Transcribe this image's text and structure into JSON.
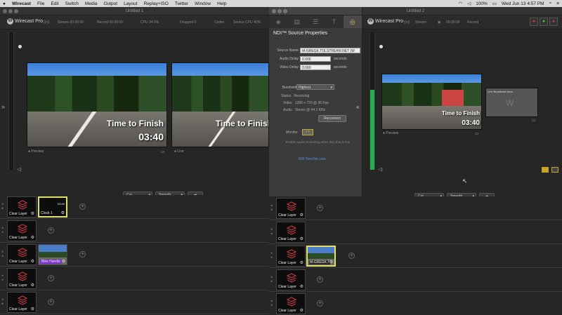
{
  "menubar": {
    "apple": "",
    "app_name": "Wirecast",
    "items": [
      "File",
      "Edit",
      "Switch",
      "Media",
      "Output",
      "Layout",
      "Replay+ISO",
      "Twitter",
      "Window",
      "Help"
    ],
    "battery": "100%",
    "datetime": "Wed Jun 13 4:57 PM"
  },
  "left_window": {
    "title": "Untitled 1",
    "logo": "Wirecast Pro",
    "stats": [
      "Stream 00:00:00",
      "Record 00:00:00",
      "CPU 34.0%",
      "Dropped 0",
      "Codec",
      "Source CPU 40%"
    ],
    "preview_label": "Preview",
    "live_label": "Live",
    "overlay_title": "Time to Finish",
    "overlay_time": "03:40",
    "transition_cut": "Cut",
    "transition_smooth": "Smooth",
    "go_label": "➔",
    "layers": [
      {
        "shots": [
          {
            "caption": "Clear Layer"
          },
          {
            "caption": "Clock 1",
            "selected": true
          }
        ]
      },
      {
        "shots": [
          {
            "caption": "Clear Layer"
          }
        ]
      },
      {
        "shots": [
          {
            "caption": "Clear Layer"
          },
          {
            "caption": "Bike Handle"
          }
        ]
      },
      {
        "shots": [
          {
            "caption": "Clear Layer"
          }
        ]
      },
      {
        "shots": [
          {
            "caption": "Clear Layer"
          }
        ]
      }
    ]
  },
  "ndi_panel": {
    "header": "NDI™ Source Properties",
    "source_name_label": "Source Name",
    "source_name_value": "M-GREGK.TOLSTREAM.NET (W",
    "audio_delay_label": "Audio Delay",
    "audio_delay_value": "0.000",
    "video_delay_label": "Video Delay",
    "video_delay_value": "0.000",
    "seconds": "seconds",
    "bandwidth_label": "Bandwidth",
    "bandwidth_value": "Highest",
    "status_label": "Status",
    "status_value": "Receiving",
    "video_label": "Video",
    "video_value": "1280 x 720 @ 30 Fps",
    "audio_label": "Audio",
    "audio_value": "Stereo @ 44.1 KHz",
    "reconnect": "Reconnect",
    "monitor_label": "Monitor",
    "monitor_note": "Enable audio monitoring when this shot is live",
    "link": "NDI NewTek.com"
  },
  "right_window": {
    "title": "Untitled 2",
    "logo": "Wirecast Pro",
    "stats": [
      "Stream",
      "00:00:00",
      "Record"
    ],
    "preview_label": "Preview",
    "overlay_title": "Time to Finish",
    "overlay_time": "03:40",
    "live_thumb_label": "Live Broadcast Area",
    "transition_cut": "Cut",
    "transition_smooth": "Smooth",
    "go_label": "➔",
    "layers": [
      {
        "shots": [
          {
            "caption": "Clear Layer"
          }
        ]
      },
      {
        "shots": [
          {
            "caption": "Clear Layer"
          }
        ]
      },
      {
        "shots": [
          {
            "caption": "Clear Layer"
          },
          {
            "caption": "M-GREGK.T",
            "selected": true
          }
        ]
      },
      {
        "shots": [
          {
            "caption": "Clear Layer"
          }
        ]
      },
      {
        "shots": [
          {
            "caption": "Clear Layer"
          }
        ]
      }
    ]
  },
  "colors": {
    "accent_yellow": "#e0e06a",
    "meter_green": "#22b14c",
    "link_blue": "#5a8ee0"
  }
}
